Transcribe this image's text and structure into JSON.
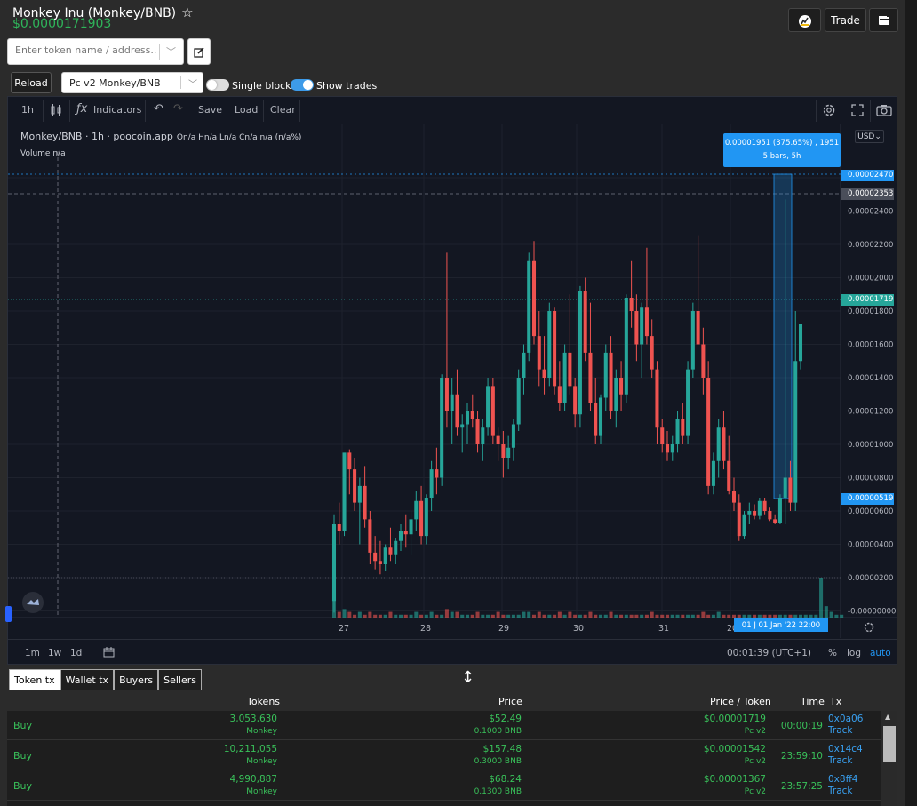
{
  "header": {
    "title": "Monkey Inu (Monkey/BNB)",
    "price": "$0.0000171903",
    "trade_label": "Trade"
  },
  "search": {
    "placeholder": "Enter token name / address..."
  },
  "controls": {
    "reload_label": "Reload",
    "pair_selected": "Pc v2 Monkey/BNB",
    "single_blocks_label": "Single blocks",
    "single_blocks_on": false,
    "show_trades_label": "Show trades",
    "show_trades_on": true
  },
  "chart_toolbar": {
    "interval": "1h",
    "indicators_label": "Indicators",
    "save_label": "Save",
    "load_label": "Load",
    "clear_label": "Clear"
  },
  "chart_legend": {
    "symbol": "Monkey/BNB · 1h · poocoin.app",
    "ohlc": "On/a Hn/a Ln/a Cn/a n/a (n/a%)",
    "volume": "Volume  n/a",
    "currency": "USD"
  },
  "tooltip": {
    "line1": "0.00001951 (375.65%) , 1951",
    "line2": "5 bars, 5h"
  },
  "price_tags": {
    "upper": "0.00002470",
    "crosshair": "0.00002353",
    "last": "0.00001719",
    "lower": "0.00000519"
  },
  "date_tag": "01 J 01 Jan '22   22:00",
  "chart_bottom": {
    "ranges": [
      "1m",
      "1w",
      "1d"
    ],
    "clock": "00:01:39 (UTC+1)",
    "pct_label": "%",
    "log_label": "log",
    "auto_label": "auto"
  },
  "chart_data": {
    "type": "candlestick",
    "x_ticks": [
      "27",
      "28",
      "29",
      "30",
      "31",
      "202"
    ],
    "y_ticks": [
      "0.00002600",
      "0.00002400",
      "0.00002200",
      "0.00002000",
      "0.00001800",
      "0.00001600",
      "0.00001400",
      "0.00001200",
      "0.00001000",
      "0.00000800",
      "0.00000600",
      "0.00000400",
      "0.00000200",
      "-0.00000000"
    ],
    "ylim": [
      -4e-07,
      2.76e-05
    ],
    "candles": [
      {
        "o": 6e-07,
        "h": 5.8e-06,
        "l": -1e-07,
        "c": 5.2e-06
      },
      {
        "o": 5.2e-06,
        "h": 6.5e-06,
        "l": 4e-06,
        "c": 4.8e-06
      },
      {
        "o": 4.8e-06,
        "h": 8.2e-06,
        "l": 4.5e-06,
        "c": 9.5e-06
      },
      {
        "o": 9.5e-06,
        "h": 9.7e-06,
        "l": 7e-06,
        "c": 8.5e-06
      },
      {
        "o": 8.5e-06,
        "h": 9.2e-06,
        "l": 6e-06,
        "c": 6.5e-06
      },
      {
        "o": 6.5e-06,
        "h": 8e-06,
        "l": 4e-06,
        "c": 7.5e-06
      },
      {
        "o": 7.5e-06,
        "h": 8.7e-06,
        "l": 5e-06,
        "c": 5.5e-06
      },
      {
        "o": 5.5e-06,
        "h": 6e-06,
        "l": 2.8e-06,
        "c": 3.5e-06
      },
      {
        "o": 3.5e-06,
        "h": 4.5e-06,
        "l": 2.5e-06,
        "c": 3e-06
      },
      {
        "o": 3e-06,
        "h": 4.2e-06,
        "l": 2.2e-06,
        "c": 2.8e-06
      },
      {
        "o": 2.8e-06,
        "h": 4e-06,
        "l": 2.4e-06,
        "c": 3.8e-06
      },
      {
        "o": 3.8e-06,
        "h": 5e-06,
        "l": 3e-06,
        "c": 3.4e-06
      },
      {
        "o": 3.4e-06,
        "h": 4.4e-06,
        "l": 2.8e-06,
        "c": 4.2e-06
      },
      {
        "o": 4.2e-06,
        "h": 5.2e-06,
        "l": 3.6e-06,
        "c": 4.8e-06
      },
      {
        "o": 4.8e-06,
        "h": 5.8e-06,
        "l": 3.8e-06,
        "c": 4.6e-06
      },
      {
        "o": 4.6e-06,
        "h": 6e-06,
        "l": 3.4e-06,
        "c": 5.5e-06
      },
      {
        "o": 5.5e-06,
        "h": 7.2e-06,
        "l": 4.8e-06,
        "c": 6.6e-06
      },
      {
        "o": 6.6e-06,
        "h": 7.5e-06,
        "l": 4e-06,
        "c": 4.5e-06
      },
      {
        "o": 4.5e-06,
        "h": 7e-06,
        "l": 4e-06,
        "c": 6.8e-06
      },
      {
        "o": 6.8e-06,
        "h": 9e-06,
        "l": 6e-06,
        "c": 8.5e-06
      },
      {
        "o": 8.5e-06,
        "h": 9.8e-06,
        "l": 7e-06,
        "c": 8e-06
      },
      {
        "o": 8e-06,
        "h": 1.42e-05,
        "l": 7.5e-06,
        "c": 1.4e-05
      },
      {
        "o": 1.4e-05,
        "h": 2.15e-05,
        "l": 1.1e-05,
        "c": 1.2e-05
      },
      {
        "o": 1.2e-05,
        "h": 1.4e-05,
        "l": 1e-05,
        "c": 1.3e-05
      },
      {
        "o": 1.3e-05,
        "h": 1.45e-05,
        "l": 1.05e-05,
        "c": 1.1e-05
      },
      {
        "o": 1.1e-05,
        "h": 1.18e-05,
        "l": 9.5e-06,
        "c": 1.12e-05
      },
      {
        "o": 1.12e-05,
        "h": 1.25e-05,
        "l": 1e-05,
        "c": 1.2e-05
      },
      {
        "o": 1.2e-05,
        "h": 1.3e-05,
        "l": 1.1e-05,
        "c": 1.15e-05
      },
      {
        "o": 1.15e-05,
        "h": 1.2e-05,
        "l": 9.5e-06,
        "c": 1e-05
      },
      {
        "o": 1e-05,
        "h": 1.15e-05,
        "l": 9e-06,
        "c": 1.1e-05
      },
      {
        "o": 1.1e-05,
        "h": 1.4e-05,
        "l": 1.05e-05,
        "c": 1.35e-05
      },
      {
        "o": 1.35e-05,
        "h": 1.4e-05,
        "l": 1e-05,
        "c": 1.05e-05
      },
      {
        "o": 1.05e-05,
        "h": 1.1e-05,
        "l": 9e-06,
        "c": 1e-05
      },
      {
        "o": 1e-05,
        "h": 1.08e-05,
        "l": 8e-06,
        "c": 9.2e-06
      },
      {
        "o": 9.2e-06,
        "h": 1.05e-05,
        "l": 8.5e-06,
        "c": 9.8e-06
      },
      {
        "o": 9.8e-06,
        "h": 1.15e-05,
        "l": 9e-06,
        "c": 1.12e-05
      },
      {
        "o": 1.12e-05,
        "h": 1.45e-05,
        "l": 1.08e-05,
        "c": 1.4e-05
      },
      {
        "o": 1.4e-05,
        "h": 1.6e-05,
        "l": 1.3e-05,
        "c": 1.55e-05
      },
      {
        "o": 1.55e-05,
        "h": 2.15e-05,
        "l": 1.5e-05,
        "c": 2.1e-05
      },
      {
        "o": 2.1e-05,
        "h": 2.22e-05,
        "l": 1.6e-05,
        "c": 1.65e-05
      },
      {
        "o": 1.65e-05,
        "h": 1.8e-05,
        "l": 1.35e-05,
        "c": 1.45e-05
      },
      {
        "o": 1.45e-05,
        "h": 1.65e-05,
        "l": 1.3e-05,
        "c": 1.4e-05
      },
      {
        "o": 1.4e-05,
        "h": 1.85e-05,
        "l": 1.35e-05,
        "c": 1.8e-05
      },
      {
        "o": 1.8e-05,
        "h": 1.82e-05,
        "l": 1.3e-05,
        "c": 1.35e-05
      },
      {
        "o": 1.35e-05,
        "h": 1.5e-05,
        "l": 1.2e-05,
        "c": 1.25e-05
      },
      {
        "o": 1.25e-05,
        "h": 1.6e-05,
        "l": 1.2e-05,
        "c": 1.55e-05
      },
      {
        "o": 1.55e-05,
        "h": 1.9e-05,
        "l": 1.3e-05,
        "c": 1.35e-05
      },
      {
        "o": 1.35e-05,
        "h": 1.4e-05,
        "l": 1.1e-05,
        "c": 1.18e-05
      },
      {
        "o": 1.18e-05,
        "h": 1.95e-05,
        "l": 1.1e-05,
        "c": 1.92e-05
      },
      {
        "o": 1.92e-05,
        "h": 2e-05,
        "l": 1.5e-05,
        "c": 1.55e-05
      },
      {
        "o": 1.55e-05,
        "h": 1.85e-05,
        "l": 1.2e-05,
        "c": 1.25e-05
      },
      {
        "o": 1.25e-05,
        "h": 1.4e-05,
        "l": 1e-05,
        "c": 1.05e-05
      },
      {
        "o": 1.05e-05,
        "h": 1.3e-05,
        "l": 1e-05,
        "c": 1.28e-05
      },
      {
        "o": 1.28e-05,
        "h": 1.6e-05,
        "l": 1.2e-05,
        "c": 1.55e-05
      },
      {
        "o": 1.55e-05,
        "h": 1.65e-05,
        "l": 1.15e-05,
        "c": 1.2e-05
      },
      {
        "o": 1.2e-05,
        "h": 1.45e-05,
        "l": 1.1e-05,
        "c": 1.4e-05
      },
      {
        "o": 1.4e-05,
        "h": 1.5e-05,
        "l": 1.2e-05,
        "c": 1.3e-05
      },
      {
        "o": 1.3e-05,
        "h": 1.9e-05,
        "l": 1.25e-05,
        "c": 1.88e-05
      },
      {
        "o": 1.88e-05,
        "h": 2.1e-05,
        "l": 1.7e-05,
        "c": 1.8e-05
      },
      {
        "o": 1.8e-05,
        "h": 1.9e-05,
        "l": 1.5e-05,
        "c": 1.6e-05
      },
      {
        "o": 1.6e-05,
        "h": 1.85e-05,
        "l": 1.4e-05,
        "c": 1.82e-05
      },
      {
        "o": 1.82e-05,
        "h": 2.18e-05,
        "l": 1.6e-05,
        "c": 1.65e-05
      },
      {
        "o": 1.65e-05,
        "h": 1.75e-05,
        "l": 1.4e-05,
        "c": 1.45e-05
      },
      {
        "o": 1.45e-05,
        "h": 1.5e-05,
        "l": 1e-05,
        "c": 1.1e-05
      },
      {
        "o": 1.1e-05,
        "h": 1.15e-05,
        "l": 9.5e-06,
        "c": 1e-05
      },
      {
        "o": 1e-05,
        "h": 1.08e-05,
        "l": 9e-06,
        "c": 9.5e-06
      },
      {
        "o": 9.5e-06,
        "h": 1.05e-05,
        "l": 9e-06,
        "c": 1e-05
      },
      {
        "o": 1e-05,
        "h": 1.2e-05,
        "l": 9.5e-06,
        "c": 1.15e-05
      },
      {
        "o": 1.15e-05,
        "h": 1.25e-05,
        "l": 1e-05,
        "c": 1.05e-05
      },
      {
        "o": 1.05e-05,
        "h": 1.5e-05,
        "l": 1e-05,
        "c": 1.45e-05
      },
      {
        "o": 1.45e-05,
        "h": 1.85e-05,
        "l": 1.4e-05,
        "c": 1.8e-05
      },
      {
        "o": 1.8e-05,
        "h": 2.25e-05,
        "l": 1.7e-05,
        "c": 1.6e-05
      },
      {
        "o": 1.6e-05,
        "h": 1.7e-05,
        "l": 1.3e-05,
        "c": 1.4e-05
      },
      {
        "o": 1.4e-05,
        "h": 1.5e-05,
        "l": 7e-06,
        "c": 7.5e-06
      },
      {
        "o": 7.5e-06,
        "h": 9.5e-06,
        "l": 7e-06,
        "c": 9e-06
      },
      {
        "o": 9e-06,
        "h": 1.15e-05,
        "l": 8e-06,
        "c": 1.1e-05
      },
      {
        "o": 1.1e-05,
        "h": 1.2e-05,
        "l": 8.5e-06,
        "c": 9e-06
      },
      {
        "o": 9e-06,
        "h": 1.05e-05,
        "l": 7e-06,
        "c": 7.2e-06
      },
      {
        "o": 7.2e-06,
        "h": 8e-06,
        "l": 6e-06,
        "c": 6.5e-06
      },
      {
        "o": 6.5e-06,
        "h": 7e-06,
        "l": 4.2e-06,
        "c": 4.5e-06
      },
      {
        "o": 4.5e-06,
        "h": 6e-06,
        "l": 4.3e-06,
        "c": 5.8e-06
      },
      {
        "o": 5.8e-06,
        "h": 6.5e-06,
        "l": 5.2e-06,
        "c": 6e-06
      },
      {
        "o": 6e-06,
        "h": 6.4e-06,
        "l": 5.5e-06,
        "c": 5.7e-06
      },
      {
        "o": 5.7e-06,
        "h": 6.8e-06,
        "l": 5.5e-06,
        "c": 6.6e-06
      },
      {
        "o": 6.6e-06,
        "h": 6.8e-06,
        "l": 5.8e-06,
        "c": 6e-06
      },
      {
        "o": 6e-06,
        "h": 6.2e-06,
        "l": 5.4e-06,
        "c": 5.5e-06
      },
      {
        "o": 5.5e-06,
        "h": 5.8e-06,
        "l": 5.2e-06,
        "c": 5.3e-06
      },
      {
        "o": 5.3e-06,
        "h": 7e-06,
        "l": 5.2e-06,
        "c": 6.8e-06
      },
      {
        "o": 6.8e-06,
        "h": 2.47e-05,
        "l": 5.2e-06,
        "c": 8e-06
      },
      {
        "o": 8e-06,
        "h": 9e-06,
        "l": 6e-06,
        "c": 6.5e-06
      },
      {
        "o": 6.5e-06,
        "h": 1.8e-05,
        "l": 6e-06,
        "c": 1.5e-05
      },
      {
        "o": 1.5e-05,
        "h": 1.72e-05,
        "l": 1.45e-05,
        "c": 1.72e-05
      }
    ],
    "volumes": [
      9,
      2,
      3,
      2,
      1,
      2,
      1,
      2,
      1,
      1,
      1,
      2,
      1,
      1,
      1,
      1,
      2,
      1,
      1,
      2,
      1,
      1,
      3,
      2,
      2,
      1,
      1,
      1,
      2,
      1,
      1,
      1,
      2,
      1,
      1,
      1,
      1,
      2,
      2,
      1,
      2,
      1,
      1,
      1,
      2,
      1,
      2,
      1,
      1,
      1,
      2,
      1,
      1,
      1,
      2,
      1,
      1,
      1,
      1,
      1,
      1,
      1,
      2,
      1,
      1,
      1,
      1,
      1,
      1,
      1,
      1,
      1,
      2,
      1,
      1,
      2,
      1,
      1,
      1,
      1,
      1,
      1,
      1,
      1,
      1,
      1,
      1,
      1,
      1,
      1,
      1,
      1,
      1,
      1,
      1,
      14,
      4,
      2,
      1,
      1
    ],
    "grid": true,
    "up_color": "#26a69a",
    "down_color": "#ef5350"
  },
  "tabs": [
    "Token tx",
    "Wallet tx",
    "Buyers",
    "Sellers"
  ],
  "tx_table": {
    "columns": [
      "Tokens",
      "Price",
      "Price / Token",
      "Time",
      "Tx"
    ],
    "rows": [
      {
        "type": "Buy",
        "tokens": "3,053,630",
        "token_sym": "Monkey",
        "usd": "$52.49",
        "bnb": "0.1000 BNB",
        "ppt": "$0.00001719",
        "pool": "Pc v2",
        "time": "00:00:19",
        "tx": "0x0a06",
        "track": "Track"
      },
      {
        "type": "Buy",
        "tokens": "10,211,055",
        "token_sym": "Monkey",
        "usd": "$157.48",
        "bnb": "0.3000 BNB",
        "ppt": "$0.00001542",
        "pool": "Pc v2",
        "time": "23:59:10",
        "tx": "0x14c4",
        "track": "Track"
      },
      {
        "type": "Buy",
        "tokens": "4,990,887",
        "token_sym": "Monkey",
        "usd": "$68.24",
        "bnb": "0.1300 BNB",
        "ppt": "$0.00001367",
        "pool": "Pc v2",
        "time": "23:57:25",
        "tx": "0x8ff4",
        "track": "Track"
      }
    ]
  },
  "colors": {
    "accent": "#2196f3",
    "buy_green": "#39c15a",
    "link_blue": "#39a0f0"
  }
}
